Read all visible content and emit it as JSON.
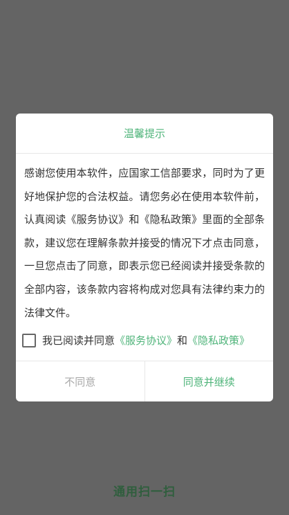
{
  "background_screen": {
    "title": "通用扫一扫"
  },
  "dialog": {
    "title": "温馨提示",
    "body_text": "感谢您使用本软件，应国家工信部要求，同时为了更好地保护您的合法权益。请您务必在使用本软件前，认真阅读《服务协议》和《隐私政策》里面的全部条款，建议您在理解条款并接受的情况下才点击同意，一旦您点击了同意，即表示您已经阅读并接受条款的全部内容，该条款内容将构成对您具有法律约束力的法律文件。",
    "agreement": {
      "checked": false,
      "prefix": "我已阅读并同意",
      "service_link": "《服务协议》",
      "and_text": "和",
      "privacy_link": "《隐私政策》"
    },
    "buttons": {
      "disagree": "不同意",
      "agree": "同意并继续"
    }
  },
  "colors": {
    "accent": "#4fb47a",
    "overlay": "#646464",
    "disabled_text": "#a8a8a8"
  }
}
